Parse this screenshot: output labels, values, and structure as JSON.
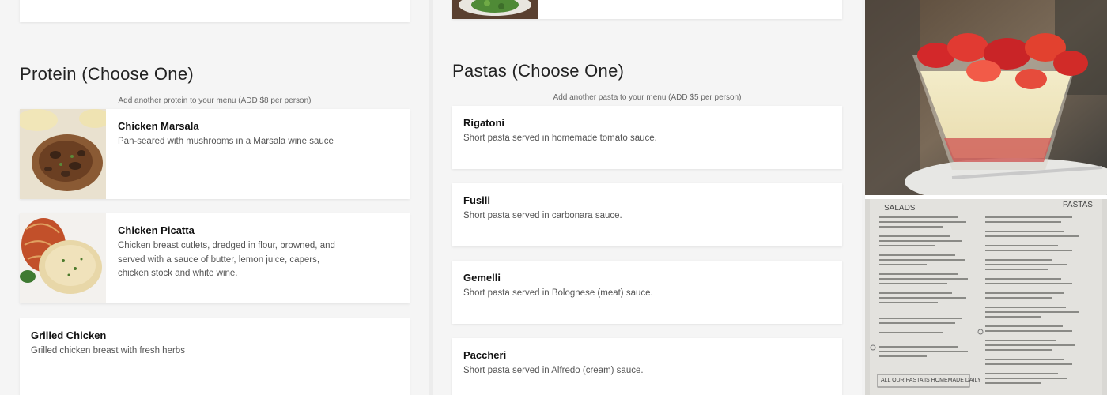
{
  "protein": {
    "title": "Protein (Choose One)",
    "note": "Add another protein to your menu (ADD $8 per person)",
    "items": [
      {
        "name": "Chicken Marsala",
        "desc": "Pan-seared with mushrooms in a Marsala wine sauce"
      },
      {
        "name": "Chicken Picatta",
        "desc": "Chicken breast cutlets, dredged in flour, browned, and served with a sauce of butter, lemon juice, capers, chicken stock and white wine."
      },
      {
        "name": "Grilled Chicken",
        "desc": "Grilled chicken breast with fresh herbs"
      }
    ]
  },
  "pastas": {
    "title": "Pastas (Choose One)",
    "note": "Add another pasta to your menu (ADD $5 per person)",
    "items": [
      {
        "name": "Rigatoni",
        "desc": "Short pasta served in homemade tomato sauce."
      },
      {
        "name": "Fusili",
        "desc": "Short pasta served in carbonara sauce."
      },
      {
        "name": "Gemelli",
        "desc": "Short pasta served in Bolognese (meat) sauce."
      },
      {
        "name": "Paccheri",
        "desc": "Short pasta served in Alfredo (cream) sauce."
      }
    ]
  },
  "menu_photo": {
    "left_heading": "SALADS",
    "right_heading": "PASTAS",
    "footer": "ALL OUR PASTA IS HOMEMADE DAILY"
  }
}
